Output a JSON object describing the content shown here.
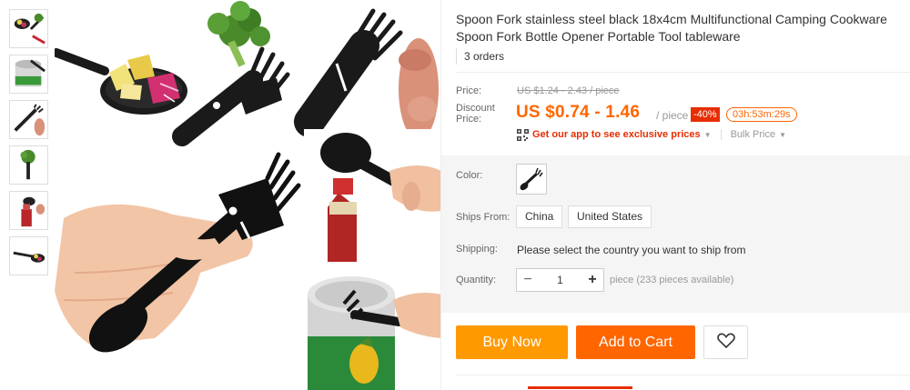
{
  "product": {
    "title": "Spoon Fork stainless steel black 18x4cm Multifunctional Camping Cookware Spoon Fork Bottle Opener Portable Tool tableware",
    "orders": "3 orders"
  },
  "pricing": {
    "price_label": "Price:",
    "old_price": "US $1.24 - 2.43 / piece",
    "discount_label": "Discount Price:",
    "discount_price": "US $0.74 - 1.46",
    "per_piece": "/ piece",
    "discount_badge": "-40%",
    "countdown": "03h:53m:29s",
    "app_promo": "Get our app to see exclusive prices",
    "bulk_price": "Bulk Price"
  },
  "options": {
    "color_label": "Color:",
    "ships_from_label": "Ships From:",
    "ships_from": [
      "China",
      "United States"
    ],
    "shipping_label": "Shipping:",
    "shipping_text": "Please select the country you want to ship from",
    "quantity_label": "Quantity:",
    "quantity_value": "1",
    "quantity_note": "piece (233 pieces available)",
    "minus": "−",
    "plus": "+"
  },
  "actions": {
    "buy_now": "Buy Now",
    "add_to_cart": "Add to Cart"
  },
  "colors": {
    "accent": "#ff6600",
    "buy_now": "#ff9900",
    "badge": "#e62e04",
    "utensil": "#1a1a1a"
  }
}
